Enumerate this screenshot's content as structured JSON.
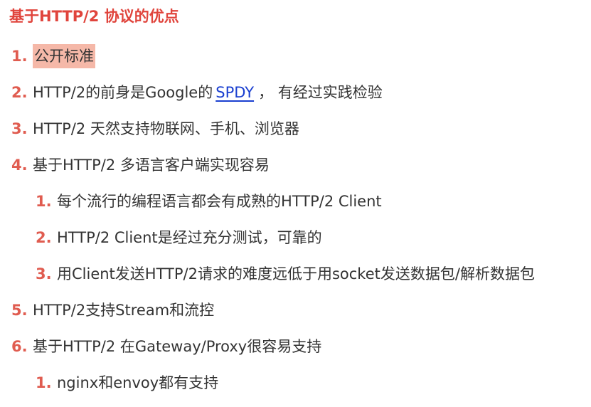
{
  "title": "基于HTTP/2 协议的优点",
  "items": [
    {
      "num": "1.",
      "text": "公开标准"
    },
    {
      "num": "2.",
      "pre": "HTTP/2的前身是Google的",
      "link": "SPDY",
      "post": "， 有经过实践检验"
    },
    {
      "num": "3.",
      "text": "HTTP/2 天然支持物联网、手机、浏览器"
    },
    {
      "num": "4.",
      "text": "基于HTTP/2 多语言客户端实现容易"
    },
    {
      "num": "1.",
      "text": "每个流行的编程语言都会有成熟的HTTP/2 Client"
    },
    {
      "num": "2.",
      "text": "HTTP/2 Client是经过充分测试，可靠的"
    },
    {
      "num": "3.",
      "text": "用Client发送HTTP/2请求的难度远低于用socket发送数据包/解析数据包"
    },
    {
      "num": "5.",
      "text": "HTTP/2支持Stream和流控"
    },
    {
      "num": "6.",
      "text": "基于HTTP/2 在Gateway/Proxy很容易支持"
    },
    {
      "num": "1.",
      "text": "nginx和envoy都有支持"
    }
  ],
  "colors": {
    "title": "#e0443c",
    "number": "#e05c50",
    "highlight": "#f5b8a8",
    "link": "#1a3fd0"
  }
}
